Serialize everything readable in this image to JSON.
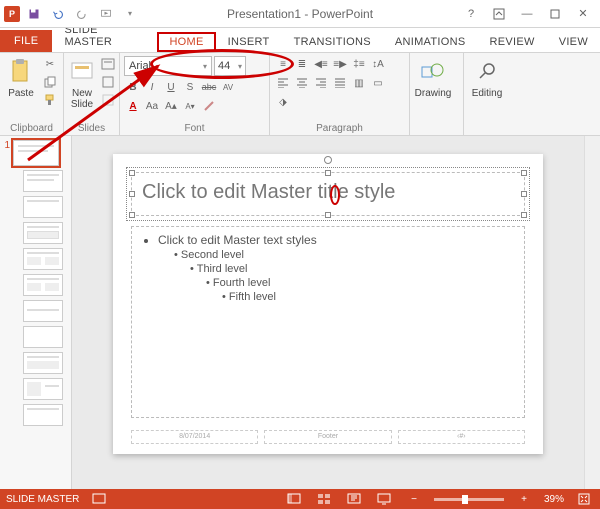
{
  "titlebar": {
    "title": "Presentation1 - PowerPoint"
  },
  "tabs": {
    "file": "FILE",
    "list": [
      "SLIDE MASTER",
      "HOME",
      "INSERT",
      "TRANSITIONS",
      "ANIMATIONS",
      "REVIEW",
      "VIEW"
    ],
    "active": "HOME"
  },
  "ribbon": {
    "clipboard": {
      "paste": "Paste",
      "label": "Clipboard"
    },
    "slides": {
      "new": "New\nSlide",
      "label": "Slides"
    },
    "font": {
      "name": "Arial",
      "size": "44",
      "label": "Font",
      "bold": "B",
      "italic": "I",
      "underline": "U",
      "shadow": "S",
      "strike": "abc",
      "spacing": "AV",
      "clear": "Aa",
      "color": "A"
    },
    "paragraph": {
      "label": "Paragraph"
    },
    "drawing": {
      "label": "Drawing"
    },
    "editing": {
      "label": "Editing"
    }
  },
  "thumbs": {
    "number": "1"
  },
  "slide": {
    "title": "Click to edit Master title style",
    "l1": "Click to edit Master text styles",
    "l2": "Second level",
    "l3": "Third level",
    "l4": "Fourth level",
    "l5": "Fifth level",
    "date": "8/07/2014",
    "footer": "Footer",
    "num": "‹#›"
  },
  "status": {
    "mode": "SLIDE MASTER",
    "zoom": "39%"
  }
}
